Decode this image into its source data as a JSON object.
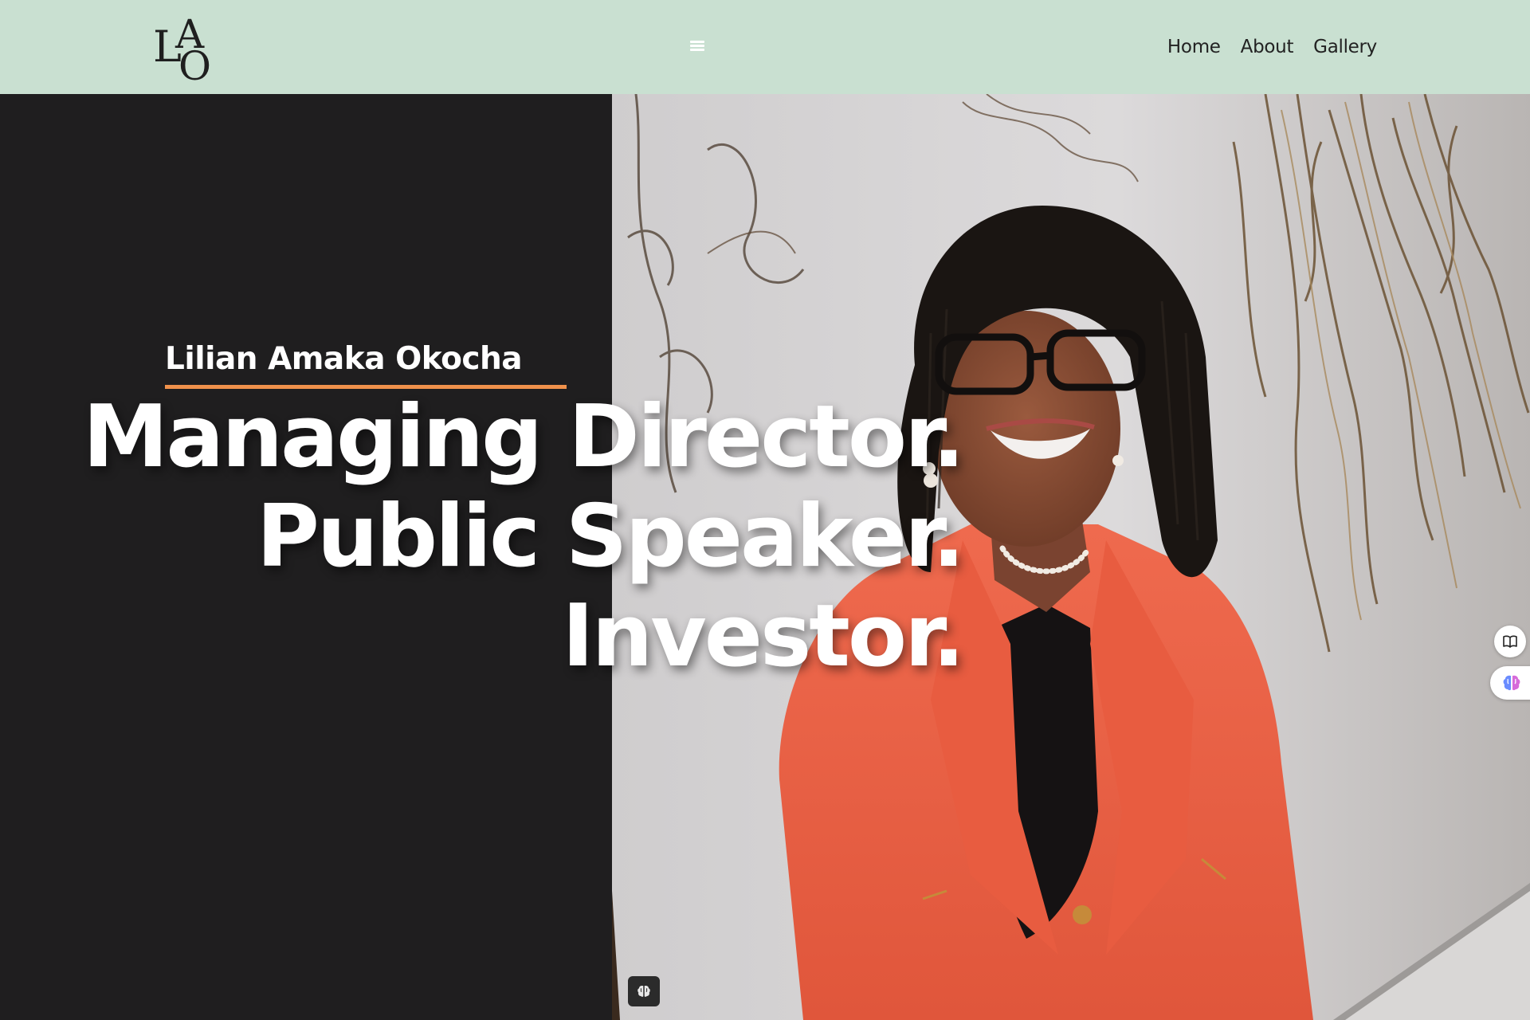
{
  "header": {
    "logo": {
      "letters": [
        "L",
        "A",
        "O"
      ]
    },
    "menu_icon": "hamburger-menu-icon",
    "nav": [
      {
        "label": "Home"
      },
      {
        "label": "About"
      },
      {
        "label": "Gallery"
      }
    ]
  },
  "hero": {
    "name": "Lilian Amaka Okocha",
    "headline": [
      "Managing Director.",
      "Public Speaker.",
      "Investor."
    ],
    "image_alt": "Portrait of Lilian Amaka Okocha"
  },
  "widgets": {
    "book_icon": "book-icon",
    "brain_icon": "brain-icon",
    "bottom_icon": "brain-icon"
  },
  "colors": {
    "header_bg": "#c9e0d1",
    "hero_left_bg": "#1f1e1f",
    "accent": "#f0914b",
    "text_light": "#ffffff",
    "nav_text": "#222222"
  }
}
